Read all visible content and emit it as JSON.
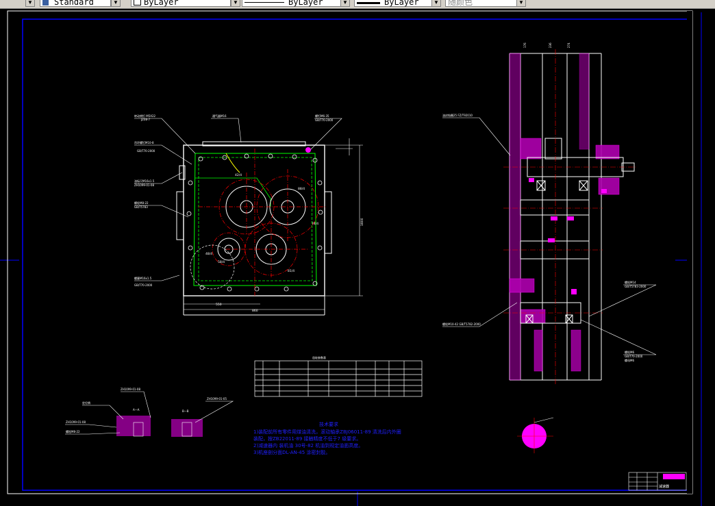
{
  "toolbar": {
    "textstyle_value": "Standard",
    "layer_color_value": "ByLayer",
    "linetype_value": "ByLayer",
    "lineweight_value": "ByLayer",
    "plotstyle_value": "随颜色"
  },
  "drawing": {
    "front_view": {
      "shaft_labels": [
        "42/4",
        "88/4",
        "74/4",
        "48/4",
        "58/4",
        "81/4",
        "88/4"
      ],
      "dims": [
        "550",
        "860",
        "1800"
      ]
    },
    "parts_table": {
      "rows": 4
    },
    "notes": {
      "title": "技术要求",
      "lines": [
        "1)装配前所有零件用煤油清洗，滚动轴承ZBJ06011-89 清洗后内外圈",
        "装配，按ZB22011-89 接触精度不低于7      级要求。",
        "2)减速器内 装机油 30号-82 机油到规定油面高度。",
        "3)机座剖分面DL-AN-45 涂密封胶。"
      ]
    },
    "title_block_text": "减速器"
  },
  "colors": {
    "background": "#000000",
    "frame": "#0000ff",
    "outline": "#ffffff",
    "center": "#ff0000",
    "section": "#ff00ff",
    "hidden": "#00ff00",
    "text_blue": "#2020ff"
  }
}
